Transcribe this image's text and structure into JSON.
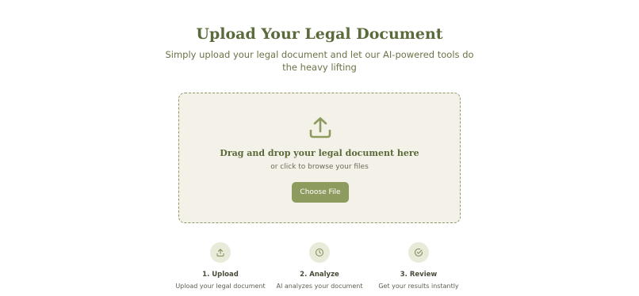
{
  "header": {
    "title": "Upload Your Legal Document",
    "subtitle": "Simply upload your legal document and let our AI-powered tools do the heavy lifting"
  },
  "dropzone": {
    "icon": "upload-icon",
    "title": "Drag and drop your legal document here",
    "subtitle": "or click to browse your files",
    "button_label": "Choose File"
  },
  "steps": [
    {
      "icon": "upload-icon",
      "title": "1. Upload",
      "description": "Upload your legal document"
    },
    {
      "icon": "clock-icon",
      "title": "2. Analyze",
      "description": "AI analyzes your document"
    },
    {
      "icon": "check-circle-icon",
      "title": "3. Review",
      "description": "Get your results instantly"
    }
  ],
  "colors": {
    "accent": "#8e9b5f",
    "heading": "#5a6a3a",
    "dropzone_bg": "#f3f1e8",
    "step_icon_bg": "#e8ebd9"
  }
}
